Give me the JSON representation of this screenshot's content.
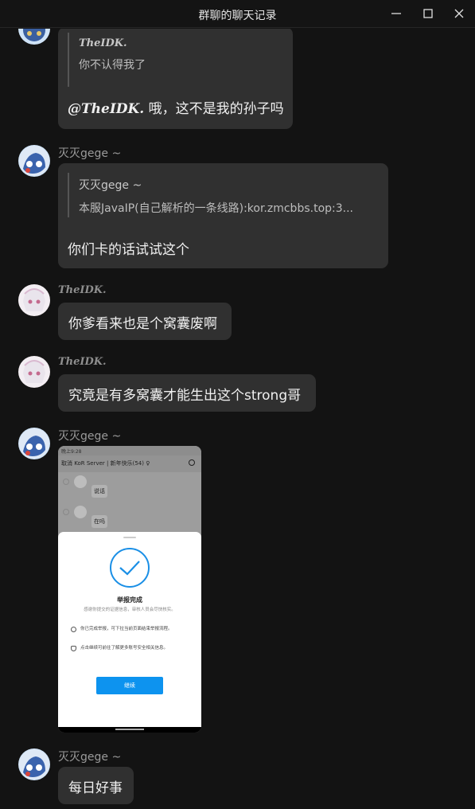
{
  "window": {
    "title": "群聊的聊天记录",
    "controls": [
      "minimize-icon",
      "maximize-icon",
      "close-icon"
    ]
  },
  "messages": [
    {
      "sender": "",
      "quote": {
        "name": "TheIDK.",
        "text": "你不认得我了"
      },
      "mention": "@TheIDK.",
      "text": " 哦，这不是我的孙子吗"
    },
    {
      "sender": "灭灭gege ~",
      "quote": {
        "name": "灭灭gege ~",
        "text": "本服JavaIP(自己解析的一条线路):kor.zmcbbs.top:3..."
      },
      "text": "你们卡的话试试这个"
    },
    {
      "sender": "TheIDK.",
      "text": "你爹看来也是个窝囊废啊"
    },
    {
      "sender": "TheIDK.",
      "text": "究竟是有多窝囊才能生出这个strong哥"
    },
    {
      "sender": "灭灭gege ~",
      "image": {
        "status_time": "晚上9:28",
        "header": "取消  KoR Server | 新年快乐(54) ♀",
        "chat_rows": [
          "说话",
          "在吗"
        ],
        "sheet_title": "举报完成",
        "sheet_subtitle": "感谢你提交的证据信息，审核人员会尽快核实。",
        "sheet_items": [
          "你已完成举报，可下拉当前页面结束举报流程。",
          "点击继续可前往了解更多账号安全相关信息。"
        ],
        "button": "继续"
      }
    },
    {
      "sender": "灭灭gege ~",
      "text": "每日好事"
    }
  ],
  "colors": {
    "background": "#131313",
    "bubble": "#303030",
    "accent": "#0d93ef"
  }
}
